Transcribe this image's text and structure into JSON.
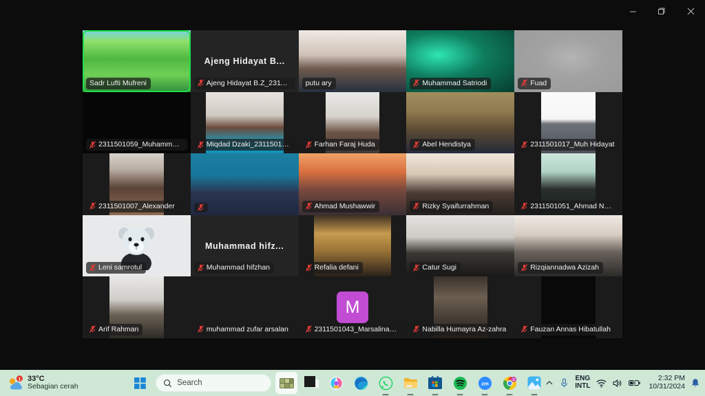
{
  "window": {
    "controls": [
      {
        "name": "minimize",
        "glyph": "minimize-icon"
      },
      {
        "name": "maximize",
        "glyph": "maximize-icon"
      },
      {
        "name": "close",
        "glyph": "close-icon"
      }
    ]
  },
  "meeting": {
    "columns": 5,
    "rows": 5,
    "speaking_border_color": "#1fe04a",
    "tiles": [
      {
        "name": "Sadr Lufti Mufreni",
        "display": "chip",
        "speaking": true,
        "muted": false,
        "cam": "on",
        "camStyle": "full",
        "bg": "linear-gradient(180deg,#77d0e8 0%,#8fe06a 18%,#4eb840 46%,#6fcf55 72%,#2f8f3a 100%)"
      },
      {
        "name": "Ajeng Hidayat B.Z_2311501020",
        "display": "name",
        "bigname": "Ajeng  Hidayat  B...",
        "muted": true,
        "cam": "off",
        "bg": "#242424"
      },
      {
        "name": "putu ary",
        "display": "chip",
        "muted": false,
        "cam": "on",
        "camStyle": "full",
        "bg": "linear-gradient(180deg,#efe9e4 0%,#cfc2b8 40%,#6e5a4e 62%,#27313f 100%)"
      },
      {
        "name": "Muhammad Satriodi",
        "display": "chip",
        "muted": true,
        "cam": "on",
        "camStyle": "full",
        "bg": "radial-gradient(ellipse at 30% 40%, #2ee6b0 0%, #0f7d5f 42%, #063c2e 100%)"
      },
      {
        "name": "Fuad",
        "display": "chip",
        "muted": true,
        "cam": "on",
        "camStyle": "full",
        "bg": "radial-gradient(ellipse at 52% 44%, #b4b4b4 0%, #a2a2a2 40%, #9a9a9a 100%)"
      },
      {
        "name": "2311501059_Muhammad Sya...",
        "display": "chip",
        "muted": true,
        "cam": "on",
        "camStyle": "full",
        "bg": "#060606"
      },
      {
        "name": "Miqdad Dzaki_2311501005",
        "display": "chip",
        "muted": true,
        "cam": "on",
        "camStyle": "midnarrow",
        "bg": "linear-gradient(180deg,#e8e4df 0%,#cfc9c2 38%,#6b4c3c 58%,#17a3c8 86%,#1390b4 100%)"
      },
      {
        "name": "Farhan Faraj Huda",
        "display": "chip",
        "muted": true,
        "cam": "on",
        "camStyle": "narrow",
        "bg": "linear-gradient(180deg,#e9e9e7 0%,#d6d2cc 40%,#6d5446 66%,#3d3a38 100%)"
      },
      {
        "name": "Abel Hendistya",
        "display": "chip",
        "muted": true,
        "cam": "on",
        "camStyle": "full",
        "bg": "linear-gradient(180deg,#a08d5e 0%,#8e7a4d 32%,#5c4a33 62%,#242b3a 100%)"
      },
      {
        "name": "2311501017_Muh Hidayat",
        "display": "chip",
        "muted": true,
        "cam": "on",
        "camStyle": "narrow",
        "bg": "linear-gradient(180deg,#fbfbfb 0%,#f6f6f6 44%,#6d7178 52%,#4d5159 100%)"
      },
      {
        "name": "2311501007_Alexander",
        "display": "chip",
        "muted": true,
        "cam": "on",
        "camStyle": "narrow",
        "bg": "linear-gradient(180deg,#d7d2cb 0%,#b9ada2 26%,#5a4336 56%,#8d6a52 100%)"
      },
      {
        "name": "",
        "display": "chip",
        "muted": true,
        "cam": "on",
        "camStyle": "full",
        "bg": "linear-gradient(180deg,#1b7fa0 0%,#17769a 36%,#2b3550 64%,#1f2740 100%)"
      },
      {
        "name": "Ahmad Mushawwir",
        "display": "chip",
        "muted": true,
        "cam": "on",
        "camStyle": "full",
        "bg": "linear-gradient(180deg,#f0a267 0%,#d9703f 30%,#7a4a3e 58%,#3b2f35 100%)"
      },
      {
        "name": "Rizky Syaifurrahman",
        "display": "chip",
        "muted": true,
        "cam": "on",
        "camStyle": "full",
        "bg": "linear-gradient(180deg,#efe7dc 0%,#d7c7b4 34%,#4a3b33 64%,#241f1d 100%)"
      },
      {
        "name": "2311501051_Ahmad Nurcholi...",
        "display": "chip",
        "muted": true,
        "cam": "on",
        "camStyle": "narrow",
        "bg": "linear-gradient(180deg,#cfe7dc 0%,#aed2c4 30%,#2a2d2b 58%,#16201b 100%)"
      },
      {
        "name": "Leni samrotul",
        "display": "chip",
        "muted": true,
        "cam": "avatar",
        "camStyle": "full",
        "bg": "#e8e9ea"
      },
      {
        "name": "Muhammad hifzhan",
        "display": "name",
        "bigname": "Muhammad  hifz...",
        "muted": true,
        "cam": "off",
        "bg": "#242424"
      },
      {
        "name": "Refalia defani",
        "display": "chip",
        "muted": true,
        "cam": "on",
        "camStyle": "midnarrow",
        "bg": "linear-gradient(180deg,#3b2f22 0%,#c79a4f 30%,#9a7336 58%,#2a211a 100%)"
      },
      {
        "name": "Catur Sugi",
        "display": "chip",
        "muted": true,
        "cam": "on",
        "camStyle": "full",
        "bg": "linear-gradient(180deg,#e3e1de 0%,#cfcbc6 36%,#3a3733 62%,#1a1918 100%)"
      },
      {
        "name": "Rizqiannadwa Azizah",
        "display": "chip",
        "muted": true,
        "cam": "on",
        "camStyle": "full",
        "bg": "linear-gradient(180deg,#efe9e3 0%,#d6ccc2 32%,#6a625c 60%,#2b2a28 100%)"
      },
      {
        "name": "Arif Rahman",
        "display": "chip",
        "muted": true,
        "cam": "on",
        "camStyle": "narrow",
        "bg": "linear-gradient(180deg,#e7e7e5 0%,#cfcdc8 38%,#6b6255 62%,#2e2b27 100%)"
      },
      {
        "name": "muhammad zufar arsalan",
        "display": "chip",
        "muted": true,
        "cam": "off",
        "bg": "#1b1b1b"
      },
      {
        "name": "2311501043_Marsalina_Teknol...",
        "display": "chip",
        "muted": true,
        "cam": "initial",
        "initial": "M",
        "initial_bg": "#c24cd4"
      },
      {
        "name": "Nabilla Humayra Az-zahra",
        "display": "chip",
        "muted": true,
        "cam": "on",
        "camStyle": "narrow",
        "bg": "linear-gradient(180deg,#3a322c 0%,#6d5f50 34%,#4a4038 64%,#211d1a 100%)"
      },
      {
        "name": "Fauzan Annas Hibatullah",
        "display": "chip",
        "muted": true,
        "cam": "on",
        "camStyle": "narrow",
        "bg": "#090909"
      }
    ]
  },
  "taskbar": {
    "background": "#cfe8d6",
    "weather": {
      "temperature": "33°C",
      "description": "Sebagian cerah",
      "badge": "1",
      "icon": "weather-sun-cloud-icon"
    },
    "start": {
      "label": "Start",
      "icon": "windows-logo-icon"
    },
    "search": {
      "placeholder": "Search",
      "icon": "search-icon"
    },
    "apps": [
      {
        "id": "zoom-meeting",
        "icon": "meeting-thumbnail-icon",
        "active": true,
        "running": false,
        "color": "#7e8a5a"
      },
      {
        "id": "file-explorer-dark",
        "icon": "app-square-icon",
        "active": false,
        "running": false,
        "color": "#1a1a1a"
      },
      {
        "id": "copilot",
        "icon": "copilot-icon",
        "active": false,
        "running": false,
        "color": "#e45ca8"
      },
      {
        "id": "edge",
        "icon": "edge-icon",
        "active": false,
        "running": false,
        "color": "#0b84d8"
      },
      {
        "id": "whatsapp",
        "icon": "whatsapp-icon",
        "active": false,
        "running": true,
        "color": "#1fb355"
      },
      {
        "id": "explorer",
        "icon": "folder-icon",
        "active": false,
        "running": true,
        "color": "#f5b940"
      },
      {
        "id": "store",
        "icon": "microsoft-store-icon",
        "active": false,
        "running": true,
        "color": "#1a4f7a"
      },
      {
        "id": "spotify",
        "icon": "spotify-icon",
        "active": false,
        "running": true,
        "color": "#1db954"
      },
      {
        "id": "zoom",
        "icon": "zoom-icon",
        "active": false,
        "running": true,
        "color": "#2d8cff"
      },
      {
        "id": "chrome",
        "icon": "chrome-icon",
        "active": false,
        "running": true,
        "color": "#e9423a"
      },
      {
        "id": "photos",
        "icon": "photos-icon",
        "active": false,
        "running": true,
        "color": "#3ba7f0"
      }
    ],
    "tray": {
      "chevron": "chevron-up-icon",
      "mic": "microphone-icon",
      "language_line1": "ENG",
      "language_line2": "INTL",
      "wifi": "wifi-icon",
      "volume": "speaker-icon",
      "battery": "battery-charging-icon",
      "time": "2:32 PM",
      "date": "10/31/2024",
      "notifications": "bell-icon"
    }
  }
}
